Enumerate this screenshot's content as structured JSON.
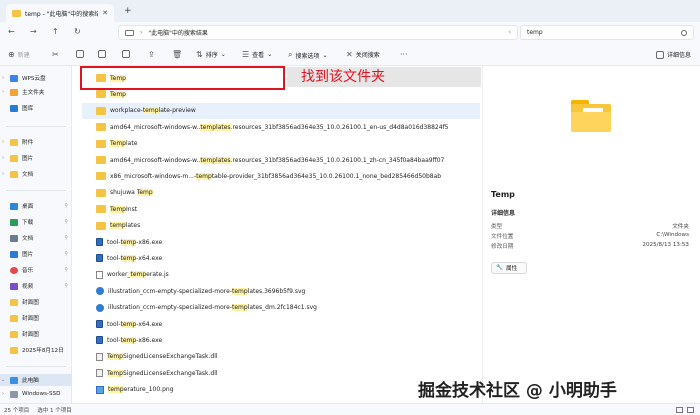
{
  "tab": {
    "label": "temp - \"此电脑\"中的搜索结果"
  },
  "address": {
    "path": "\"此电脑\"中的搜索结果",
    "search_value": "temp"
  },
  "commands": {
    "new": "新建",
    "sort": "排序",
    "view": "查看",
    "search_options": "搜索选项",
    "close_search": "关闭搜索",
    "details": "详细信息"
  },
  "sidebar": {
    "items": [
      {
        "label": "WPS云盘"
      },
      {
        "label": "主文件夹"
      },
      {
        "label": "图库"
      },
      {
        "label": "附件"
      },
      {
        "label": "图片"
      },
      {
        "label": "文档"
      },
      {
        "label": "桌面"
      },
      {
        "label": "下载"
      },
      {
        "label": "文档"
      },
      {
        "label": "图片"
      },
      {
        "label": "音乐"
      },
      {
        "label": "视频"
      },
      {
        "label": "封面图"
      },
      {
        "label": "封面图"
      },
      {
        "label": "封面图"
      },
      {
        "label": "2025年8月12日"
      },
      {
        "label": "此电脑"
      },
      {
        "label": "Windows-SSD"
      }
    ]
  },
  "files": [
    {
      "pre": "",
      "hl": "Temp",
      "post": "",
      "type": "folder"
    },
    {
      "pre": "",
      "hl": "Temp",
      "post": "",
      "type": "folder"
    },
    {
      "pre": "workplace-",
      "hl": "temp",
      "post": "late-preview",
      "type": "folder"
    },
    {
      "pre": "amd64_microsoft-windows-w..",
      "hl": "templates",
      "post": ".resources_31bf3856ad364e35_10.0.26100.1_en-us_d4d8a016d38824f5",
      "type": "folder"
    },
    {
      "pre": "",
      "hl": "Temp",
      "post": "late",
      "type": "folder"
    },
    {
      "pre": "amd64_microsoft-windows-w..",
      "hl": "templates",
      "post": ".resources_31bf3856ad364e35_10.0.26100.1_zh-cn_345f0a84baa9ff07",
      "type": "folder"
    },
    {
      "pre": "x86_microsoft-windows-m...-",
      "hl": "temp",
      "post": "table-provider_31bf3856ad364e35_10.0.26100.1_none_bed285466d50b8ab",
      "type": "folder"
    },
    {
      "pre": "shujuwa ",
      "hl": "Temp",
      "post": "",
      "type": "folder"
    },
    {
      "pre": "",
      "hl": "Temp",
      "post": "Inst",
      "type": "folder"
    },
    {
      "pre": "",
      "hl": "temp",
      "post": "lates",
      "type": "folder"
    },
    {
      "pre": "tool-",
      "hl": "temp",
      "post": "-x86.exe",
      "type": "exe"
    },
    {
      "pre": "tool-",
      "hl": "temp",
      "post": "-x64.exe",
      "type": "exe"
    },
    {
      "pre": "worker_",
      "hl": "temp",
      "post": "erate.js",
      "type": "js"
    },
    {
      "pre": "illustration_ccm-empty-specialized-more-",
      "hl": "temp",
      "post": "lates.3696b5f9.svg",
      "type": "svg"
    },
    {
      "pre": "illustration_ccm-empty-specialized-more-",
      "hl": "temp",
      "post": "lates_dm.2fc184c1.svg",
      "type": "svg"
    },
    {
      "pre": "tool-",
      "hl": "temp",
      "post": "-x64.exe",
      "type": "exe"
    },
    {
      "pre": "tool-",
      "hl": "temp",
      "post": "-x86.exe",
      "type": "exe"
    },
    {
      "pre": "",
      "hl": "Temp",
      "post": "SignedLicenseExchangeTask.dll",
      "type": "dll"
    },
    {
      "pre": "",
      "hl": "Temp",
      "post": "SignedLicenseExchangeTask.dll",
      "type": "dll"
    },
    {
      "pre": "",
      "hl": "temp",
      "post": "erature_100.png",
      "type": "png"
    }
  ],
  "annotation": "找到该文件夹",
  "details": {
    "title": "Temp",
    "section": "详细信息",
    "rows": [
      {
        "k": "类型",
        "v": "文件夹"
      },
      {
        "k": "文件位置",
        "v": "C:\\Windows"
      },
      {
        "k": "修改日期",
        "v": "2025/8/13 13:53"
      }
    ],
    "properties": "属性"
  },
  "status": {
    "count": "25 个项目",
    "selected": "选中 1 个项目"
  },
  "watermark": "掘金技术社区 @ 小明助手"
}
